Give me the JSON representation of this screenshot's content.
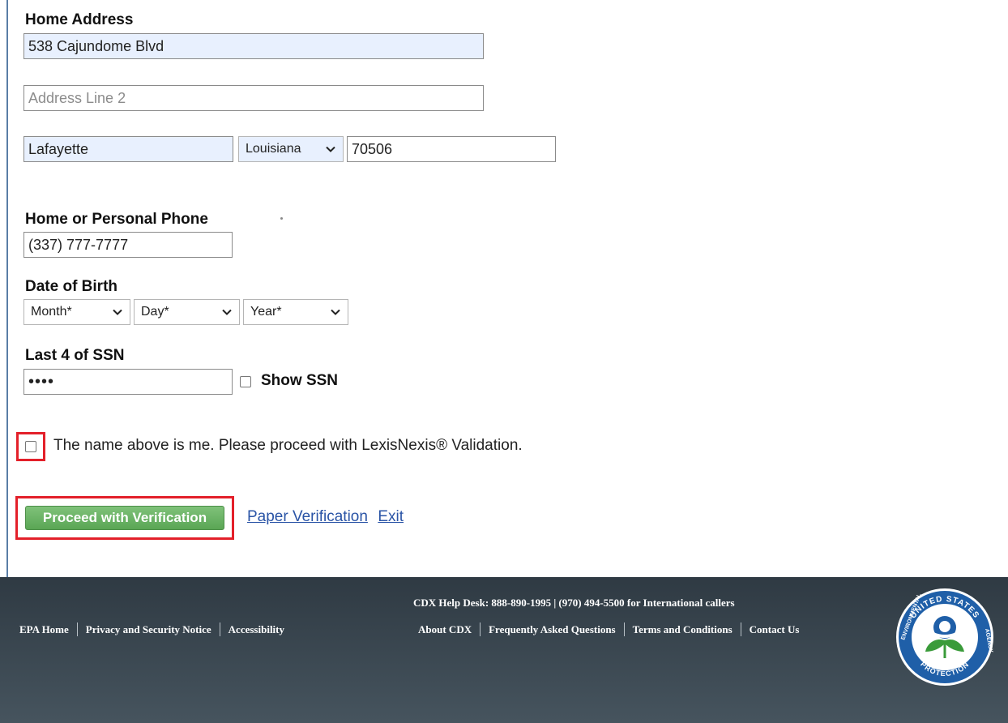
{
  "address": {
    "label": "Home Address",
    "line1_value": "538 Cajundome Blvd",
    "line2_placeholder": "Address Line 2",
    "city_value": "Lafayette",
    "state_value": "Louisiana",
    "zip_value": "70506"
  },
  "phone": {
    "label": "Home or Personal Phone",
    "value": "(337) 777-7777"
  },
  "dob": {
    "label": "Date of Birth",
    "month": "Month*",
    "day": "Day*",
    "year": "Year*"
  },
  "ssn": {
    "label": "Last 4 of SSN",
    "value": "••••",
    "show_label": "Show SSN"
  },
  "consent": {
    "text": "The name above is me. Please proceed with LexisNexis® Validation."
  },
  "actions": {
    "proceed": "Proceed with Verification",
    "paper": "Paper Verification",
    "exit": "Exit"
  },
  "footer": {
    "left_links": [
      "EPA Home",
      "Privacy and Security Notice",
      "Accessibility"
    ],
    "help_desk": "CDX Help Desk: 888-890-1995 | (970) 494-5500 for International callers",
    "right_links": [
      "About CDX",
      "Frequently Asked Questions",
      "Terms and Conditions",
      "Contact Us"
    ],
    "seal_top": "UNITED STATES",
    "seal_left": "ENVIRONMENTAL",
    "seal_right": "AGENCY",
    "seal_bottom": "PROTECTION"
  },
  "colors": {
    "autofill_bg": "#e8f0fe",
    "highlight_red": "#e3202a",
    "button_green": "#5aa654",
    "link_blue": "#2a54a6",
    "footer_bg": "#2f3a43"
  }
}
